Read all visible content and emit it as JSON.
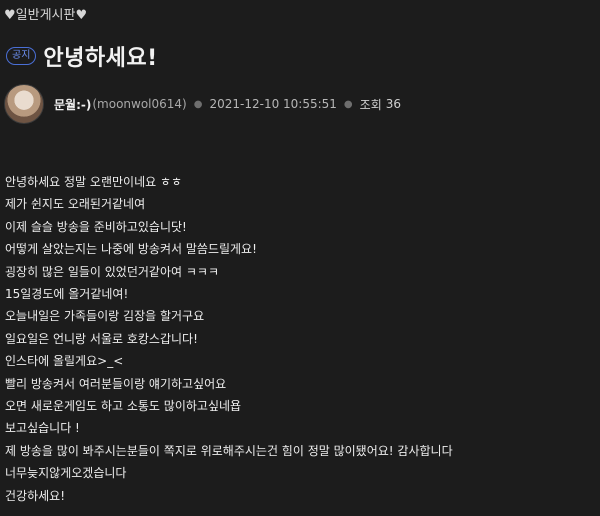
{
  "board": {
    "name": "♥일반게시판♥"
  },
  "post": {
    "badge": "공지",
    "title": "안녕하세요!",
    "author": {
      "nickname": "문월:-)",
      "user_id": "(moonwol0614)"
    },
    "date": "2021-12-10 10:55:51",
    "views_label": "조회",
    "views": "36",
    "content_lines": [
      "안녕하세요 정말 오랜만이네요 ㅎㅎ",
      "제가 쉰지도 오래된거같네여",
      "이제 슬슬 방송을 준비하고있습니닷!",
      "어떻게 살았는지는 나중에 방송켜서 말씀드릴게요!",
      "굉장히 많은 일들이 있었던거같아여 ㅋㅋㅋ",
      "15일경도에 올거같네여!",
      "오늘내일은 가족들이랑 김장을 할거구요",
      "일요일은 언니랑 서울로 호캉스갑니다!",
      "인스타에 올릴게요>_<",
      "빨리 방송켜서 여러분들이랑 얘기하고싶어요",
      "오면 새로운게임도 하고 소통도 많이하고싶네욥",
      "보고싶습니다 !",
      "제 방송을 많이 봐주시는분들이 쪽지로 위로해주시는건 힘이 정말 많이됐어요! 감사합니다",
      "너무늦지않게오겠습니다",
      "건강하세요!"
    ]
  }
}
